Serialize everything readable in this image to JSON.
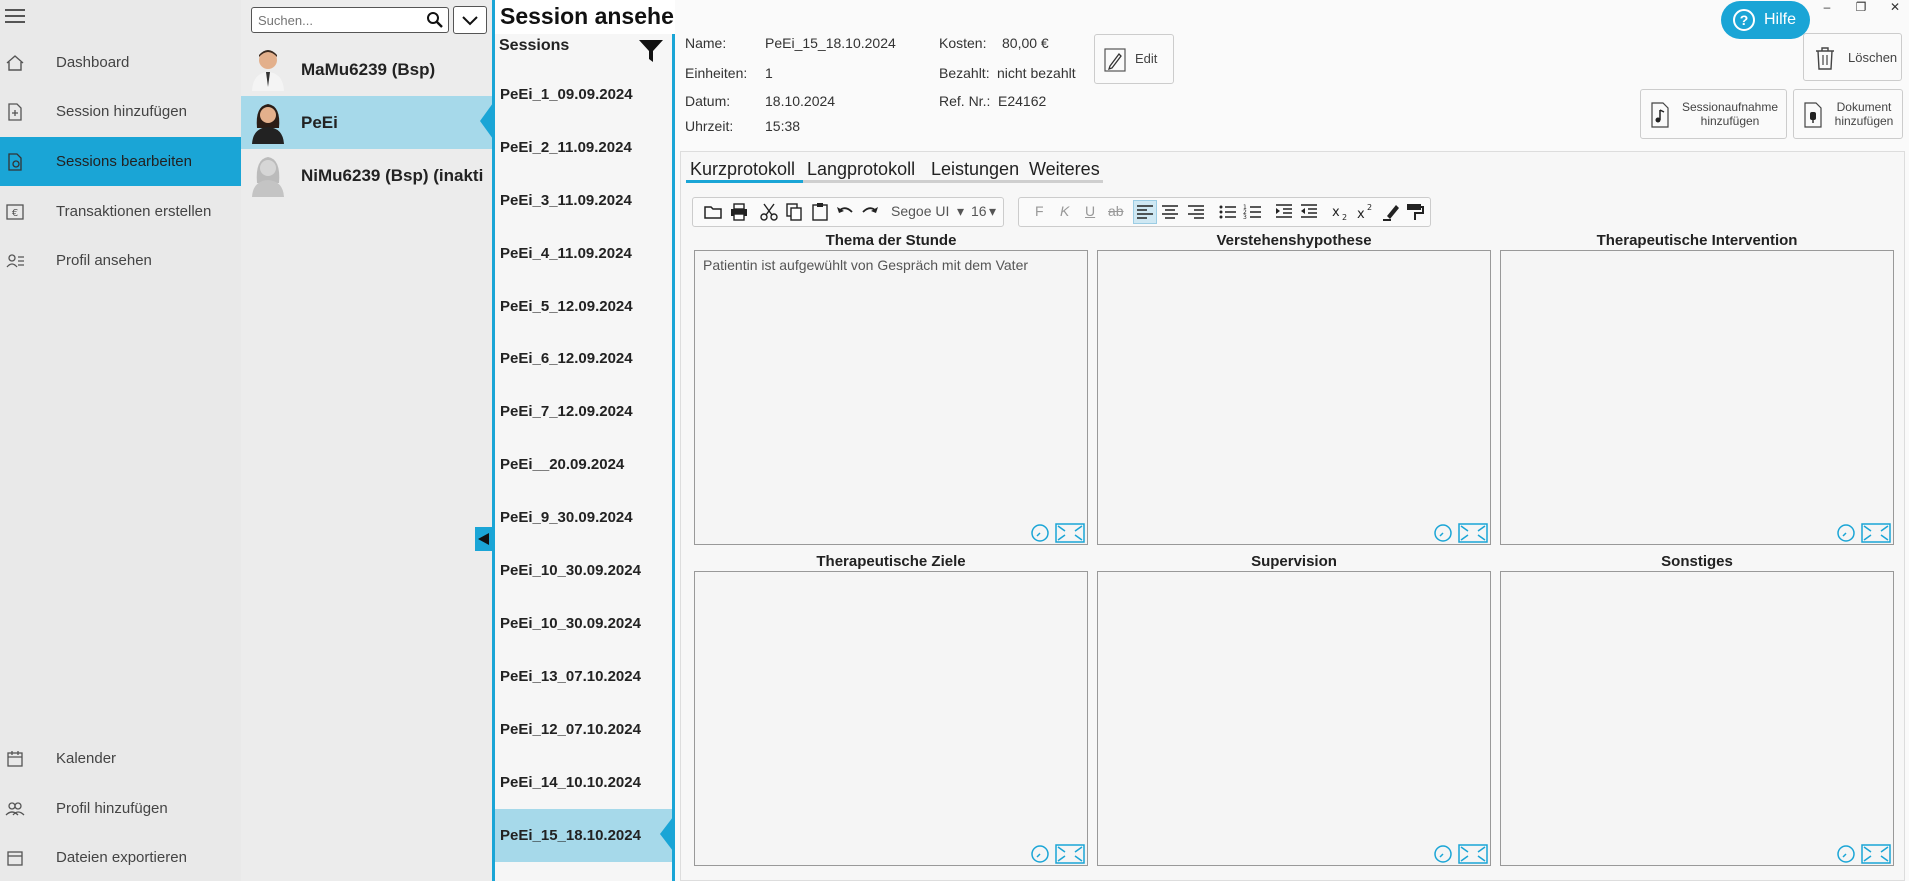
{
  "nav": {
    "items": [
      {
        "label": "Dashboard",
        "icon": "home-icon"
      },
      {
        "label": "Session hinzufügen",
        "icon": "add-session-icon"
      },
      {
        "label": "Sessions bearbeiten",
        "icon": "edit-session-icon"
      },
      {
        "label": "Transaktionen erstellen",
        "icon": "euro-icon"
      },
      {
        "label": "Profil ansehen",
        "icon": "profile-icon"
      },
      {
        "label": "Kalender",
        "icon": "calendar-icon"
      },
      {
        "label": "Profil hinzufügen",
        "icon": "add-profile-icon"
      },
      {
        "label": "Dateien exportieren",
        "icon": "export-icon"
      }
    ],
    "active_index": 2
  },
  "clients": {
    "search_placeholder": "Suchen...",
    "items": [
      {
        "name": "MaMu6239 (Bsp)"
      },
      {
        "name": "PeEi"
      },
      {
        "name": "NiMu6239 (Bsp) (inakti"
      }
    ],
    "active_index": 1
  },
  "page_title": "Session ansehen",
  "sessions": {
    "header": "Sessions",
    "items": [
      "PeEi_1_09.09.2024",
      "PeEi_2_11.09.2024",
      "PeEi_3_11.09.2024",
      "PeEi_4_11.09.2024",
      "PeEi_5_12.09.2024",
      "PeEi_6_12.09.2024",
      "PeEi_7_12.09.2024",
      "PeEi__20.09.2024",
      "PeEi_9_30.09.2024",
      "PeEi_10_30.09.2024",
      "PeEi_10_30.09.2024",
      "PeEi_13_07.10.2024",
      "PeEi_12_07.10.2024",
      "PeEi_14_10.10.2024",
      "PeEi_15_18.10.2024"
    ],
    "active_index": 14
  },
  "meta": {
    "name_label": "Name:",
    "name": "PeEi_15_18.10.2024",
    "units_label": "Einheiten:",
    "units": "1",
    "date_label": "Datum:",
    "date": "18.10.2024",
    "time_label": "Uhrzeit:",
    "time": "15:38",
    "cost_label": "Kosten:",
    "cost": "80,00 €",
    "paid_label": "Bezahlt:",
    "paid": "nicht bezahlt",
    "ref_label": "Ref. Nr.:",
    "ref": "E24162"
  },
  "buttons": {
    "edit": "Edit",
    "delete": "Löschen",
    "add_recording_1": "Sessionaufnahme",
    "add_recording_2": "hinzufügen",
    "add_document_1": "Dokument",
    "add_document_2": "hinzufügen",
    "help": "Hilfe"
  },
  "tabs": [
    "Kurzprotokoll",
    "Langprotokoll",
    "Leistungen",
    "Weiteres"
  ],
  "active_tab": 0,
  "toolbar": {
    "font": "Segoe UI",
    "size": "16",
    "bold": "F",
    "italic": "K",
    "underline": "U",
    "strike": "ab"
  },
  "fields": [
    {
      "title": "Thema der Stunde",
      "value": "Patientin ist aufgewühlt von Gespräch mit dem Vater"
    },
    {
      "title": "Verstehenshypothese",
      "value": ""
    },
    {
      "title": "Therapeutische Intervention",
      "value": ""
    },
    {
      "title": "Therapeutische Ziele",
      "value": ""
    },
    {
      "title": "Supervision",
      "value": ""
    },
    {
      "title": "Sonstiges",
      "value": ""
    }
  ],
  "colors": {
    "accent": "#1aa5d6",
    "selected": "#a6d9ea",
    "nav_bg": "#e9e9e9"
  }
}
